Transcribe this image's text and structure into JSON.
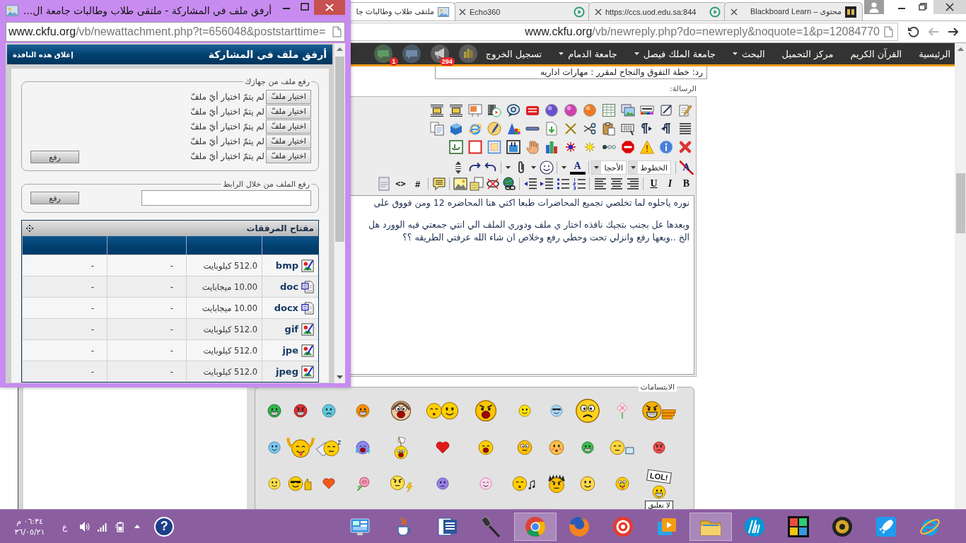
{
  "popup": {
    "title": "أرفق ملف في المشاركة - ملتقى طلاب وطالبات جامعة ال...",
    "url": "www.ckfu.org/vb/newattachment.php?t=656048&poststarttime=",
    "header": {
      "title": "أرفق ملف في المشاركة",
      "close_link": "إغلاق هذه النافذة"
    },
    "device_upload": {
      "legend": "رفع ملف من جهازك",
      "file_inputs": [
        {
          "button": "اختيار ملفّ",
          "status": "لم يتمّ اختيار أيّ ملفّ"
        },
        {
          "button": "اختيار ملفّ",
          "status": "لم يتمّ اختيار أيّ ملفّ"
        },
        {
          "button": "اختيار ملفّ",
          "status": "لم يتمّ اختيار أيّ ملفّ"
        },
        {
          "button": "اختيار ملفّ",
          "status": "لم يتمّ اختيار أيّ ملفّ"
        },
        {
          "button": "اختيار ملفّ",
          "status": "لم يتمّ اختيار أيّ ملفّ"
        }
      ],
      "submit": "رفع"
    },
    "link_upload": {
      "legend": "رفع الملف من خلال الرابط",
      "submit": "رفع"
    },
    "attachments": {
      "title": "مفتاح المرفقات",
      "rows": [
        {
          "kind": "image",
          "extension": "bmp",
          "size": "512.0 كيلوبايت",
          "column_3": "-",
          "column_4": "-"
        },
        {
          "kind": "document",
          "extension": "doc",
          "size": "10.00 ميجابايت",
          "column_3": "-",
          "column_4": "-"
        },
        {
          "kind": "document",
          "extension": "docx",
          "size": "10.00 ميجابايت",
          "column_3": "-",
          "column_4": "-"
        },
        {
          "kind": "image",
          "extension": "gif",
          "size": "512.0 كيلوبايت",
          "column_3": "-",
          "column_4": "-"
        },
        {
          "kind": "image",
          "extension": "jpe",
          "size": "512.0 كيلوبايت",
          "column_3": "-",
          "column_4": "-"
        },
        {
          "kind": "image",
          "extension": "jpeg",
          "size": "512.0 كيلوبايت",
          "column_3": "-",
          "column_4": "-"
        }
      ]
    }
  },
  "browser": {
    "tabs": [
      {
        "label": "محتوى – Blackboard Learn",
        "selected": false,
        "kind": "tile"
      },
      {
        "label": "https://ccs.uod.edu.sa:844",
        "selected": false,
        "kind": "ring"
      },
      {
        "label": "Echo360",
        "selected": false,
        "kind": "ring"
      },
      {
        "label": "ملتقى طلاب وطالبات جا",
        "selected": true,
        "kind": "picture"
      }
    ],
    "url": "www.ckfu.org/vb/newreply.php?do=newreply&noquote=1&p=12084770",
    "nav": [
      {
        "label": "الرئيسية",
        "dropdown": false
      },
      {
        "label": "القرآن الكريم",
        "dropdown": false
      },
      {
        "label": "مركز التحميل",
        "dropdown": false
      },
      {
        "label": "البحث",
        "dropdown": true
      },
      {
        "label": "جامعة الملك فيصل",
        "dropdown": true
      },
      {
        "label": "جامعة الدمام",
        "dropdown": true
      },
      {
        "label": "تسجيل الخروج",
        "dropdown": false
      }
    ],
    "nav_icons": [
      {
        "kind": "chart"
      },
      {
        "kind": "megaphone",
        "badge": "294"
      },
      {
        "kind": "chat"
      },
      {
        "kind": "message",
        "badge": "1"
      }
    ],
    "subject": "رد: خطة التفوق والنجاح لمقرر : مهارات اداريه",
    "message_label": "الرسالة:",
    "editor": {
      "glyph_buttons": [
        {
          "kind": "remove-format",
          "label": "A"
        },
        {
          "kind": "font-color",
          "label": "A"
        },
        {
          "kind": "bold",
          "label": "B"
        },
        {
          "kind": "italic",
          "label": "I"
        },
        {
          "kind": "underline",
          "label": "U"
        },
        {
          "kind": "hash",
          "label": "#"
        },
        {
          "kind": "code",
          "label": "<>"
        }
      ],
      "font_select": "الخطوط",
      "size_select": "الأحجا",
      "message_lines": [
        "نوره ياحلوه لما تخلصي تجميع المحاضرات طبعا اكتي هنا المحاضره 12 ومن فووق على",
        "وبعدها عل بجنب بتجيك نافذه اختار ي ملف ودوري الملف الي انتي جمعتي فيه الوورد هل",
        "الخ ..وبعها رفع وانزلي تحت وحطي رفع وخلاص ان شاء الله عرفتي الطريقه ؟؟"
      ]
    },
    "smilies": {
      "legend": "الابتسامات",
      "sign_texts": [
        "LOL!",
        "لا تعليق"
      ]
    }
  },
  "taskbar": {
    "time": "٠٦:٣٤ م",
    "date": "٣٦/٠٥/٢١",
    "language": "ع",
    "help": "?",
    "apps": [
      {
        "kind": "panel",
        "active": false
      },
      {
        "kind": "cup",
        "active": false
      },
      {
        "kind": "word",
        "active": false
      },
      {
        "kind": "microphone",
        "active": false
      },
      {
        "kind": "tricolor",
        "active": true
      },
      {
        "kind": "fox",
        "active": false
      },
      {
        "kind": "r-ring",
        "active": false
      },
      {
        "kind": "player",
        "active": false
      },
      {
        "kind": "folder",
        "active": true
      },
      {
        "kind": "circle-logo",
        "active": false
      },
      {
        "kind": "puzzle",
        "active": false
      },
      {
        "kind": "speaker",
        "active": false
      },
      {
        "kind": "rocket",
        "active": false
      },
      {
        "kind": "e-globe",
        "active": false
      }
    ]
  }
}
